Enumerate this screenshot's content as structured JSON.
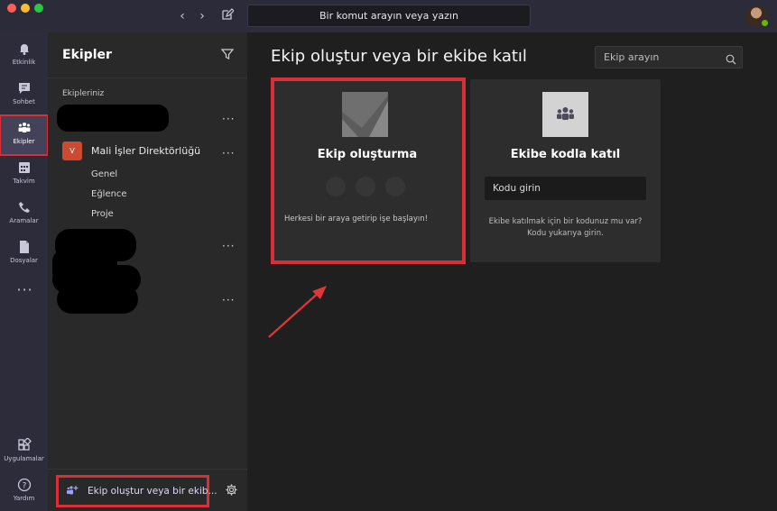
{
  "titlebar": {
    "command_placeholder": "Bir komut arayın veya yazın"
  },
  "rail": {
    "items": [
      {
        "label": "Etkinlik",
        "icon": "bell-icon"
      },
      {
        "label": "Sohbet",
        "icon": "chat-icon"
      },
      {
        "label": "Ekipler",
        "icon": "teams-icon"
      },
      {
        "label": "Takvim",
        "icon": "calendar-icon"
      },
      {
        "label": "Aramalar",
        "icon": "phone-icon"
      },
      {
        "label": "Dosyalar",
        "icon": "file-icon"
      },
      {
        "label": "Uygulamalar",
        "icon": "apps-icon"
      },
      {
        "label": "Yardım",
        "icon": "help-icon"
      }
    ]
  },
  "teams_panel": {
    "title": "Ekipler",
    "section_label": "Ekipleriniz",
    "team": {
      "badge": "V",
      "name": "Mali İşler Direktörlüğü",
      "channels": [
        "Genel",
        "Eğlence",
        "Proje"
      ]
    },
    "join_or_create_label": "Ekip oluştur veya bir ekib..."
  },
  "main": {
    "title": "Ekip oluştur veya bir ekibe katıl",
    "search_placeholder": "Ekip arayın",
    "create_card": {
      "title": "Ekip oluşturma",
      "description": "Herkesi bir araya getirip işe başlayın!"
    },
    "join_card": {
      "title": "Ekibe kodla katıl",
      "code_placeholder": "Kodu girin",
      "hint_line1": "Ekibe katılmak için bir kodunuz mu var?",
      "hint_line2": "Kodu yukarıya girin."
    }
  },
  "colors": {
    "highlight": "#d92f36",
    "rail_bg": "#2d2c3b",
    "accent": "#9ea2ff"
  }
}
